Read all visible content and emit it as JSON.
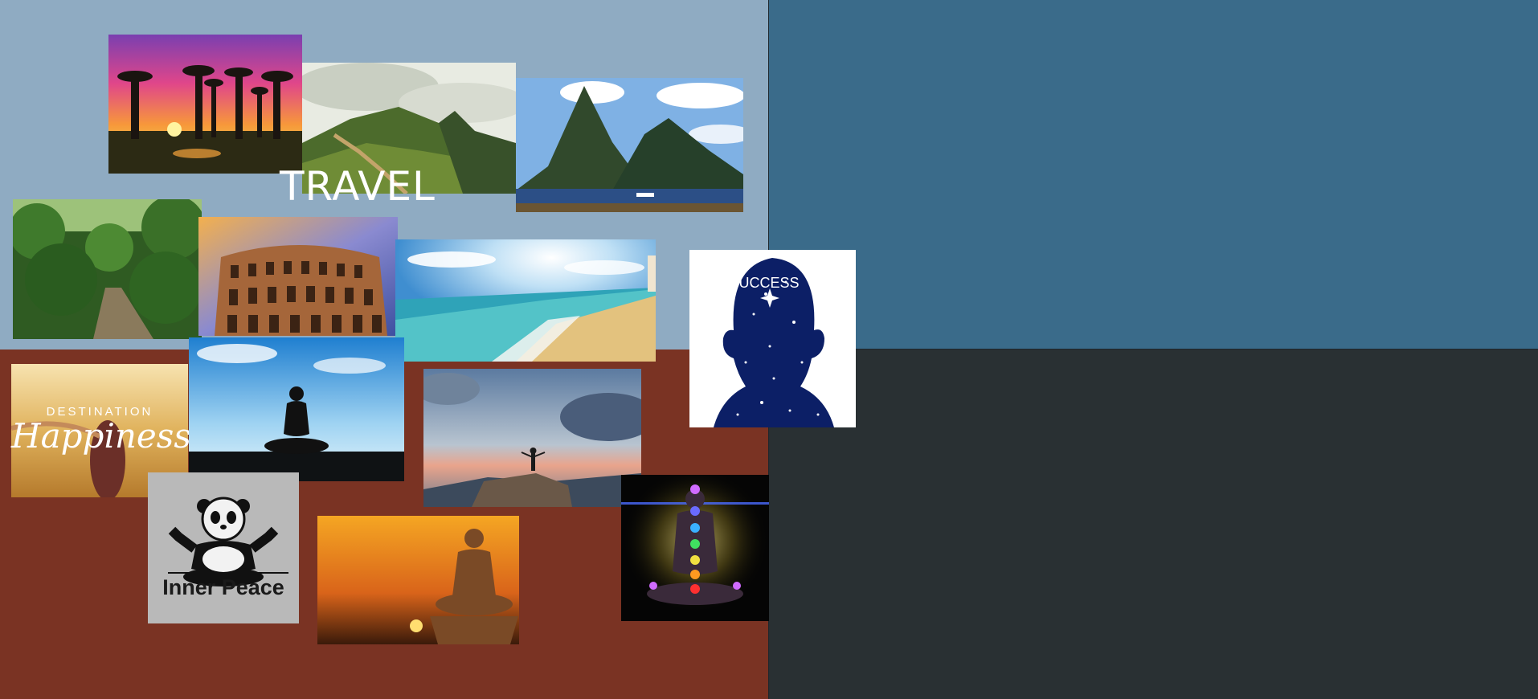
{
  "board": {
    "quadrants": {
      "top_left": "#8fabc2",
      "top_right": "#3a6b8a",
      "bottom_left": "#7a3323",
      "bottom_right": "#293033"
    }
  },
  "labels": {
    "travel": "TRAVEL",
    "success": "SUCCESS",
    "destination": "DESTINATION",
    "happiness": "Happiness",
    "inner_peace": "Inner Peace"
  },
  "tiles": [
    {
      "name": "baobab-sunset-photo"
    },
    {
      "name": "mountain-stairs-photo"
    },
    {
      "name": "twin-peaks-photo"
    },
    {
      "name": "jungle-path-photo"
    },
    {
      "name": "colosseum-photo"
    },
    {
      "name": "beach-photo"
    },
    {
      "name": "success-head-image"
    },
    {
      "name": "destination-happiness-image"
    },
    {
      "name": "meditation-sky-photo"
    },
    {
      "name": "rock-summit-photo"
    },
    {
      "name": "inner-peace-panda-image"
    },
    {
      "name": "buddha-sunset-photo"
    },
    {
      "name": "chakra-meditation-image"
    }
  ]
}
